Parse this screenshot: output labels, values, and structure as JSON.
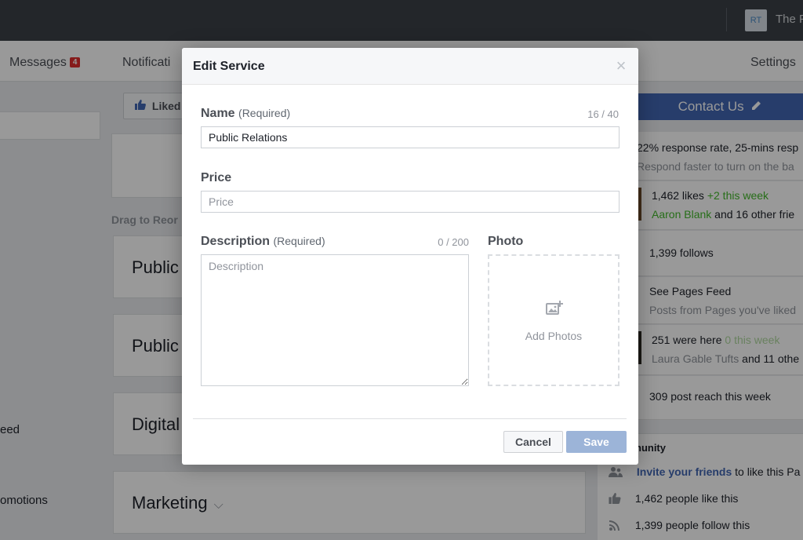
{
  "topbar": {
    "avatar_initials": "RT",
    "page_name": "The P"
  },
  "nav": {
    "messages_label": "Messages",
    "messages_badge": "4",
    "notifications_label": "Notificati",
    "settings_label": "Settings"
  },
  "left": {
    "link_1": "eed",
    "link_2": "omotions"
  },
  "mid": {
    "liked_label": "Liked",
    "drag_label": "Drag to Reor",
    "services": [
      "Public",
      "Public",
      "Digital",
      "Marketing"
    ]
  },
  "right": {
    "contact_label": "Contact Us",
    "response_rate": "22% response rate, 25-mins resp",
    "response_hint": "Respond faster to turn on the ba",
    "likes_count": "1,462 likes",
    "likes_delta": "+2 this week",
    "likes_friend": "Aaron Blank",
    "likes_friend_rest": " and 16 other frie",
    "follows": "1,399 follows",
    "pages_feed_title": "See Pages Feed",
    "pages_feed_sub": "Posts from Pages you've liked",
    "were_here": "251 were here",
    "were_here_delta": "0 this week",
    "were_here_friend": "Laura Gable Tufts",
    "were_here_rest": " and 11 othe",
    "post_reach": "309 post reach this week",
    "community_title": "nunity",
    "invite_link": "Invite your friends",
    "invite_rest": " to like this Pa",
    "people_like": "1,462 people like this",
    "people_follow": "1,399 people follow this"
  },
  "modal": {
    "title": "Edit Service",
    "close_glyph": "×",
    "name_label": "Name",
    "name_required": "(Required)",
    "name_counter": "16 / 40",
    "name_value": "Public Relations",
    "price_label": "Price",
    "price_placeholder": "Price",
    "description_label": "Description",
    "description_required": "(Required)",
    "description_counter": "0 / 200",
    "description_placeholder": "Description",
    "photo_label": "Photo",
    "add_photos_label": "Add Photos",
    "cancel_label": "Cancel",
    "save_label": "Save"
  },
  "icons": {
    "close": "close-icon",
    "add_photo": "add-photo-icon",
    "edit": "pencil-icon",
    "like": "thumbs-up-icon"
  },
  "colors": {
    "accent": "#4267b2",
    "save_disabled": "#9cb4d8",
    "badge": "#e02e2e",
    "topbar": "#3b4046",
    "positive": "#42b72a"
  }
}
